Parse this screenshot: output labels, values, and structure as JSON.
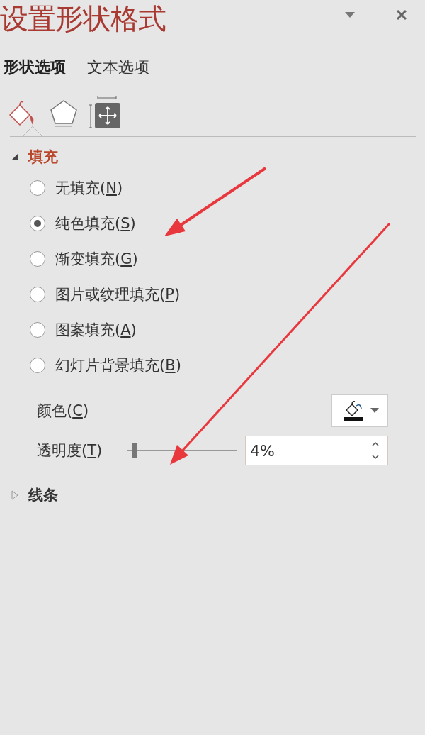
{
  "pane": {
    "title": "设置形状格式"
  },
  "tabs": [
    {
      "label": "形状选项",
      "selected": true
    },
    {
      "label": "文本选项",
      "selected": false
    }
  ],
  "icon_tabs": [
    {
      "kind": "fill",
      "selected": true
    },
    {
      "kind": "effects",
      "selected": false
    },
    {
      "kind": "size",
      "selected": false
    }
  ],
  "fill_section": {
    "title": "填充",
    "expanded": true,
    "options": [
      {
        "before": "无填充(",
        "key": "N",
        "after": ")",
        "selected": false
      },
      {
        "before": "纯色填充(",
        "key": "S",
        "after": ")",
        "selected": true
      },
      {
        "before": "渐变填充(",
        "key": "G",
        "after": ")",
        "selected": false
      },
      {
        "before": "图片或纹理填充(",
        "key": "P",
        "after": ")",
        "selected": false
      },
      {
        "before": "图案填充(",
        "key": "A",
        "after": ")",
        "selected": false
      },
      {
        "before": "幻灯片背景填充(",
        "key": "B",
        "after": ")",
        "selected": false
      }
    ],
    "color": {
      "before": "颜色(",
      "key": "C",
      "after": ")"
    },
    "transparency": {
      "before": "透明度(",
      "key": "T",
      "after": ")",
      "level": 0.04,
      "value": "4%"
    }
  },
  "line_section": {
    "title": "线条",
    "expanded": false
  }
}
